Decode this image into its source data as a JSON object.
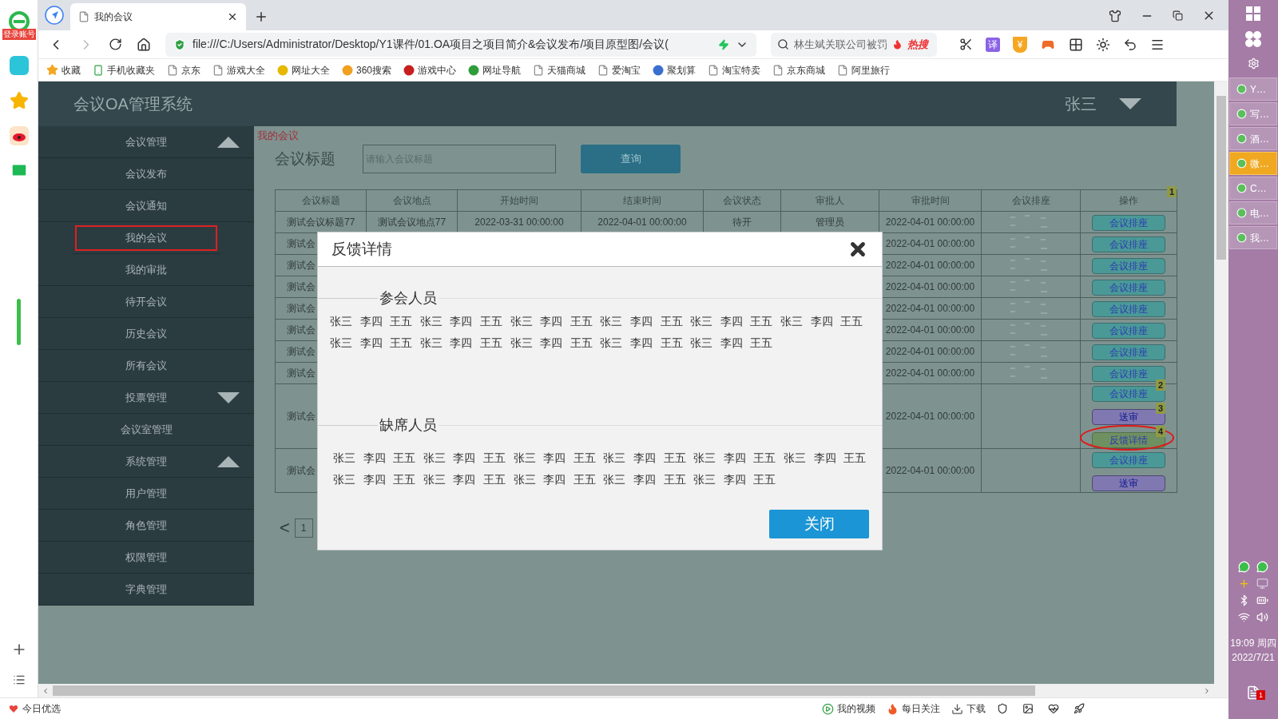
{
  "browser": {
    "tab": {
      "title": "我的会议"
    },
    "address": "file:///C:/Users/Administrator/Desktop/Y1课件/01.OA项目之项目简介&会议发布/项目原型图/会议(",
    "search": {
      "hint": "林生斌关联公司被罚",
      "hot": "热搜"
    },
    "toolbar": {
      "translate": "译",
      "coin": "¥"
    },
    "bookmarks": [
      {
        "kind": "star",
        "label": "收藏"
      },
      {
        "kind": "phone",
        "label": "手机收藏夹"
      },
      {
        "kind": "page",
        "label": "京东"
      },
      {
        "kind": "page",
        "label": "游戏大全"
      },
      {
        "kind": "site",
        "label": "网址大全",
        "color": "#e6b800"
      },
      {
        "kind": "site",
        "label": "360搜索",
        "color": "#f0a020"
      },
      {
        "kind": "site",
        "label": "游戏中心",
        "color": "#c81e1e"
      },
      {
        "kind": "site",
        "label": "网址导航",
        "color": "#2e9e3a"
      },
      {
        "kind": "page",
        "label": "天猫商城"
      },
      {
        "kind": "page",
        "label": "爱淘宝"
      },
      {
        "kind": "site",
        "label": "聚划算",
        "color": "#3a6fd0"
      },
      {
        "kind": "page",
        "label": "淘宝特卖"
      },
      {
        "kind": "page",
        "label": "京东商城"
      },
      {
        "kind": "page",
        "label": "阿里旅行"
      }
    ]
  },
  "left_rail": {
    "login": "登录账号"
  },
  "app": {
    "title": "会议OA管理系统",
    "user": "张三",
    "sidebar": [
      {
        "kind": "group",
        "label": "会议管理",
        "expanded": true
      },
      {
        "kind": "item",
        "label": "会议发布",
        "selected": false
      },
      {
        "kind": "item",
        "label": "会议通知",
        "selected": false
      },
      {
        "kind": "item",
        "label": "我的会议",
        "selected": true
      },
      {
        "kind": "item",
        "label": "我的审批",
        "selected": false
      },
      {
        "kind": "item",
        "label": "待开会议",
        "selected": false
      },
      {
        "kind": "item",
        "label": "历史会议",
        "selected": false
      },
      {
        "kind": "item",
        "label": "所有会议",
        "selected": false
      },
      {
        "kind": "group",
        "label": "投票管理",
        "expanded": false
      },
      {
        "kind": "item",
        "label": "会议室管理",
        "selected": false
      },
      {
        "kind": "group",
        "label": "系统管理",
        "expanded": true
      },
      {
        "kind": "item",
        "label": "用户管理",
        "selected": false
      },
      {
        "kind": "item",
        "label": "角色管理",
        "selected": false
      },
      {
        "kind": "item",
        "label": "权限管理",
        "selected": false
      },
      {
        "kind": "item",
        "label": "字典管理",
        "selected": false
      }
    ],
    "breadcrumb": "我的会议",
    "search": {
      "label": "会议标题",
      "placeholder": "请输入会议标题",
      "button": "查询"
    },
    "table": {
      "columns": [
        "会议标题",
        "会议地点",
        "开始时间",
        "结束时间",
        "会议状态",
        "审批人",
        "审批时间",
        "会议排座",
        "操作"
      ],
      "header_badge": "1",
      "rows": [
        {
          "title": "测试会议标题77",
          "location": "测试会议地点77",
          "start": "2022-03-31 00:00:00",
          "end": "2022-04-01 00:00:00",
          "status": "待开",
          "approver": "管理员",
          "approved_at": "2022-04-01 00:00:00",
          "seat_chart": true,
          "actions": [
            {
              "kind": "seat",
              "label": "会议排座",
              "highlighted": false
            }
          ]
        },
        {
          "title": "测试会",
          "approved_at": "2022-04-01 00:00:00",
          "seat_chart": true,
          "actions": [
            {
              "kind": "seat",
              "label": "会议排座",
              "highlighted": false
            }
          ]
        },
        {
          "title": "测试会",
          "approved_at": "2022-04-01 00:00:00",
          "seat_chart": true,
          "actions": [
            {
              "kind": "seat",
              "label": "会议排座",
              "highlighted": false
            }
          ]
        },
        {
          "title": "测试会",
          "approved_at": "2022-04-01 00:00:00",
          "seat_chart": true,
          "actions": [
            {
              "kind": "seat",
              "label": "会议排座",
              "highlighted": false
            }
          ]
        },
        {
          "title": "测试会",
          "approved_at": "2022-04-01 00:00:00",
          "seat_chart": true,
          "actions": [
            {
              "kind": "seat",
              "label": "会议排座",
              "highlighted": false
            }
          ]
        },
        {
          "title": "测试会",
          "approved_at": "2022-04-01 00:00:00",
          "seat_chart": true,
          "actions": [
            {
              "kind": "seat",
              "label": "会议排座",
              "highlighted": false
            }
          ]
        },
        {
          "title": "测试会",
          "approved_at": "2022-04-01 00:00:00",
          "seat_chart": true,
          "actions": [
            {
              "kind": "seat",
              "label": "会议排座",
              "highlighted": false
            }
          ]
        },
        {
          "title": "测试会",
          "approved_at": "2022-04-01 00:00:00",
          "seat_chart": true,
          "actions": [
            {
              "kind": "seat",
              "label": "会议排座",
              "highlighted": false
            }
          ]
        },
        {
          "title": "测试会",
          "approved_at": "2022-04-01 00:00:00",
          "seat_chart": false,
          "actions": [
            {
              "kind": "seat",
              "label": "会议排座",
              "badge": "2",
              "highlighted": false
            },
            {
              "kind": "submit",
              "label": "送审",
              "badge": "3",
              "highlighted": false
            },
            {
              "kind": "feedback",
              "label": "反馈详情",
              "badge": "4",
              "highlighted": true
            }
          ]
        },
        {
          "title": "测试会",
          "approved_at": "2022-04-01 00:00:00",
          "seat_chart": false,
          "actions": [
            {
              "kind": "seat",
              "label": "会议排座",
              "highlighted": false
            },
            {
              "kind": "submit",
              "label": "送审",
              "highlighted": false
            }
          ]
        }
      ]
    },
    "pagination": {
      "prev": "<",
      "pages": [
        "1"
      ]
    },
    "modal": {
      "title": "反馈详情",
      "button": "关闭",
      "sections": [
        {
          "heading": "参会人员",
          "names": [
            "张三",
            "李四",
            "王五",
            "张三",
            "李四",
            "王五",
            "张三",
            "李四",
            "王五",
            "张三",
            "李四",
            "王五",
            "张三",
            "李四",
            "王五",
            "张三",
            "李四",
            "王五",
            "张三",
            "李四",
            "王五",
            "张三",
            "李四",
            "王五",
            "张三",
            "李四",
            "王五",
            "张三",
            "李四",
            "王五",
            "张三",
            "李四",
            "王五"
          ]
        },
        {
          "heading": "缺席人员",
          "names": [
            "张三",
            "李四",
            "王五",
            "张三",
            "李四",
            "王五",
            "张三",
            "李四",
            "王五",
            "张三",
            "李四",
            "王五",
            "张三",
            "李四",
            "王五",
            "张三",
            "李四",
            "王五",
            "张三",
            "李四",
            "王五",
            "张三",
            "李四",
            "王五",
            "张三",
            "李四",
            "王五",
            "张三",
            "李四",
            "王五",
            "张三",
            "李四",
            "王五"
          ]
        }
      ]
    }
  },
  "right_rail": {
    "tasks": [
      {
        "label": "Y…",
        "active": false
      },
      {
        "label": "写…",
        "active": false
      },
      {
        "label": "酒…",
        "active": false
      },
      {
        "label": "微…",
        "active": true
      },
      {
        "label": "C…",
        "active": false
      },
      {
        "label": "电…",
        "active": false
      },
      {
        "label": "我…",
        "active": false
      }
    ],
    "time": "19:09 周四",
    "date": "2022/7/21",
    "notifications": "1"
  },
  "status_bar": {
    "left": "今日优选",
    "items": [
      {
        "kind": "video",
        "label": "我的视频"
      },
      {
        "kind": "hot",
        "label": "每日关注"
      },
      {
        "kind": "download",
        "label": "下载"
      }
    ]
  }
}
